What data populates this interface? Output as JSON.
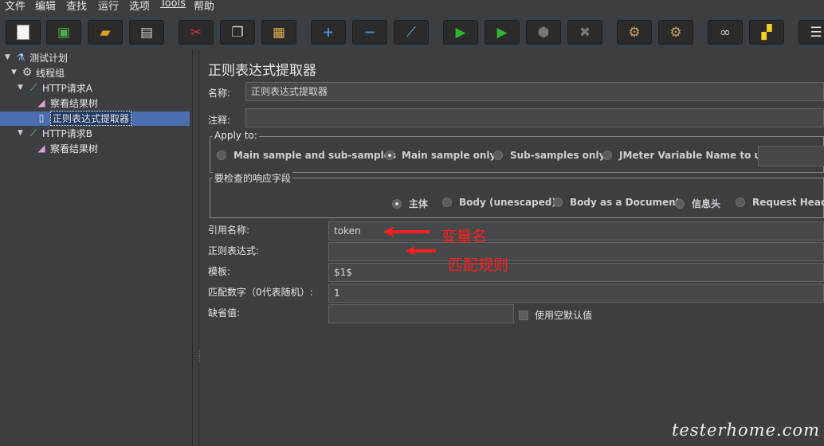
{
  "menu": [
    "文件",
    "编辑",
    "查找",
    "运行",
    "选项",
    "Tools",
    "帮助"
  ],
  "tree": {
    "items": [
      {
        "label": "测试计划"
      },
      {
        "label": "线程组"
      },
      {
        "label": "HTTP请求A"
      },
      {
        "label": "察看结果树"
      },
      {
        "label": "正则表达式提取器"
      },
      {
        "label": "HTTP请求B"
      },
      {
        "label": "察看结果树"
      }
    ]
  },
  "panel": {
    "title": "正则表达式提取器",
    "name_label": "名称:",
    "name_value": "正则表达式提取器",
    "comment_label": "注释:",
    "comment_value": "",
    "apply_to": {
      "title": "Apply to:",
      "options": [
        "Main sample and sub-samples",
        "Main sample only",
        "Sub-samples only",
        "JMeter Variable Name to use"
      ],
      "selected": "Main sample only"
    },
    "field_check": {
      "title": "要检查的响应字段",
      "options": [
        "主体",
        "Body (unescaped)",
        "Body as a Document",
        "信息头",
        "Request Headers"
      ],
      "selected": "主体"
    },
    "ref_name_label": "引用名称:",
    "ref_name_value": "token",
    "regex_label": "正则表达式:",
    "regex_value": "",
    "template_label": "模板:",
    "template_value": "$1$",
    "match_no_label": "匹配数字（0代表随机）:",
    "match_no_value": "1",
    "default_label": "缺省值:",
    "default_value": "",
    "use_empty_label": "使用空默认值"
  },
  "annotations": {
    "var_name": "变量名",
    "match_rule": "匹配规则"
  },
  "watermark": "testerhome.com",
  "colors": {
    "background": "#3c3f41",
    "selection": "#4b6eaf",
    "annotation": "#ff1f1f"
  }
}
